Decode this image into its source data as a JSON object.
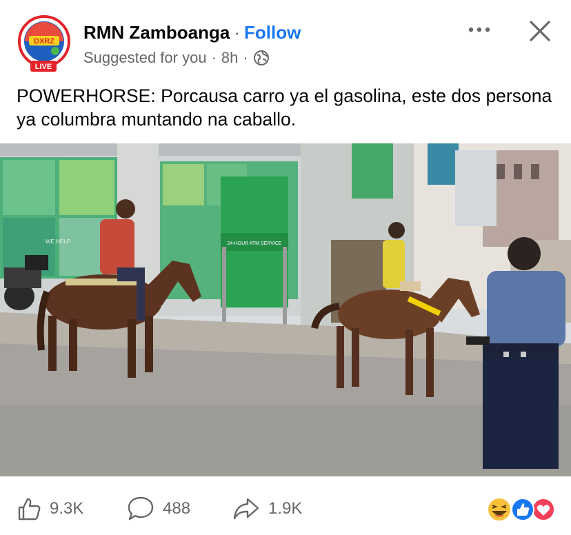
{
  "post": {
    "page_name": "RMN Zamboanga",
    "separator": "·",
    "follow_label": "Follow",
    "suggested": "Suggested for you",
    "time": "8h",
    "live_badge": "LIVE",
    "logo_text": "DXRZ",
    "caption": "POWERHORSE: Porcausa carro ya el gasolina, este dos persona ya columbra muntando na caballo.",
    "photo": {
      "sign_text": "24-HOUR ATM SERVICE",
      "wall_text": "WE HELP"
    },
    "footer": {
      "likes": "9.3K",
      "comments": "488",
      "shares": "1.9K"
    }
  },
  "colors": {
    "accent": "#1877f2",
    "secondary_text": "#65676b",
    "live_red": "#e4232a"
  },
  "icons": [
    "globe-icon",
    "more-icon",
    "close-icon",
    "like-icon",
    "comment-icon",
    "share-icon",
    "haha-reaction-icon",
    "like-reaction-icon",
    "love-reaction-icon"
  ]
}
